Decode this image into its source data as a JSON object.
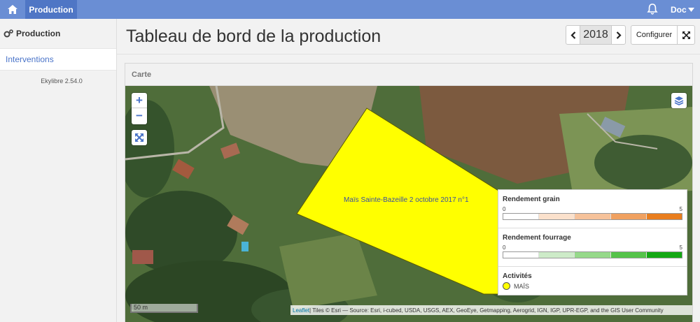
{
  "topbar": {
    "home_icon": "home-icon",
    "active_tab": "Production",
    "bell_icon": "bell-icon",
    "user_label": "Doc"
  },
  "sidebar": {
    "heading": "Production",
    "heading_icon": "gears-icon",
    "items": [
      {
        "label": "Interventions",
        "active": true
      }
    ],
    "version": "Ekylibre 2.54.0"
  },
  "page": {
    "title": "Tableau de bord de la production",
    "year": "2018",
    "prev_icon": "chevron-left-icon",
    "next_icon": "chevron-right-icon",
    "configure_label": "Configurer",
    "fullscreen_icon": "expand-icon"
  },
  "card": {
    "title": "Carte",
    "map": {
      "zoom_in": "+",
      "zoom_out": "−",
      "fit_icon": "fit-bounds-icon",
      "layers_icon": "layers-icon",
      "plot_label": "Maïs Sainte-Bazeille 2 octobre 2017 n°1",
      "plot_color": "#ffff00",
      "scale_label": "50 m",
      "attribution_link": "Leaflet",
      "attribution_text": " | Tiles © Esri — Source: Esri, i-cubed, USDA, USGS, AEX, GeoEye, Getmapping, Aerogrid, IGN, IGP, UPR-EGP, and the GIS User Community"
    },
    "legend": {
      "grain": {
        "title": "Rendement grain",
        "min": "0",
        "max": "5",
        "colors": [
          "#ffffff",
          "#fbe1cc",
          "#f6c29a",
          "#f0a160",
          "#e97e1e"
        ]
      },
      "forage": {
        "title": "Rendement fourrage",
        "min": "0",
        "max": "5",
        "colors": [
          "#ffffff",
          "#cdebc8",
          "#96d98a",
          "#55c34a",
          "#14a814"
        ]
      },
      "activities": {
        "title": "Activités",
        "items": [
          {
            "label": "MAÏS",
            "color": "#ffff00"
          }
        ]
      }
    }
  }
}
